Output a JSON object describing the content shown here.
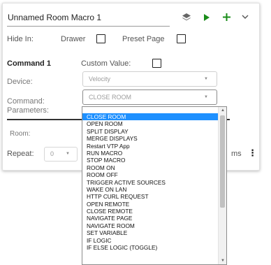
{
  "macro": {
    "title": "Unnamed Room Macro 1"
  },
  "hide_in": {
    "label": "Hide In:",
    "drawer_label": "Drawer",
    "preset_page_label": "Preset Page"
  },
  "command": {
    "heading": "Command 1",
    "custom_value_label": "Custom Value:",
    "device_label": "Device:",
    "device_value": "Velocity",
    "command_label": "Command:",
    "command_value": "CLOSE ROOM",
    "parameters_label": "Parameters:",
    "room_label": "Room:",
    "repeat_label": "Repeat:",
    "repeat_value": "0",
    "ms_label": "ms"
  },
  "dropdown": {
    "options": [
      "CLOSE ROOM",
      "OPEN ROOM",
      "SPLIT DISPLAY",
      "MERGE DISPLAYS",
      "Restart VTP App",
      "RUN MACRO",
      "STOP MACRO",
      "ROOM ON",
      "ROOM OFF",
      "TRIGGER ACTIVE SOURCES",
      "WAKE ON LAN",
      "HTTP CURL REQUEST",
      "OPEN REMOTE",
      "CLOSE REMOTE",
      "NAVIGATE PAGE",
      "NAVIGATE ROOM",
      "SET VARIABLE",
      "IF LOGIC",
      "IF ELSE LOGIC (TOGGLE)"
    ],
    "selected": "CLOSE ROOM"
  },
  "colors": {
    "play_green": "#1a8c1a",
    "add_green": "#1a8c1a",
    "selected_blue": "#1e90ff"
  },
  "icons": {
    "layers": "layers-icon",
    "play": "play-icon",
    "add": "plus-icon",
    "expand": "chevron-down-icon",
    "more": "kebab-menu-icon"
  }
}
